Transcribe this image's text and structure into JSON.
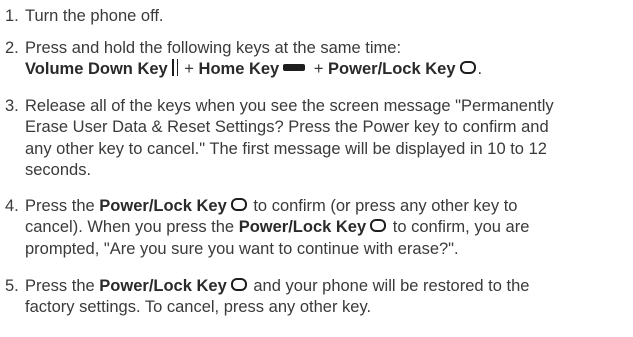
{
  "steps": [
    {
      "number": "1.",
      "text": "Turn the phone off."
    },
    {
      "number": "2.",
      "line1": "Press and hold the following keys at the same time:",
      "vol_label": "Volume Down Key",
      "plus1": " + ",
      "home_label": "Home Key",
      "plus2": " + ",
      "power_label": "Power/Lock Key",
      "end": "."
    },
    {
      "number": "3.",
      "lines": [
        "Release all of the keys when you see the screen message \"Permanently",
        "Erase User Data & Reset Settings? Press the Power key to confirm and",
        "any other key to cancel.\" The first message will be displayed in 10 to 12",
        "seconds."
      ]
    },
    {
      "number": "4.",
      "a1": "Press the ",
      "a2": "Power/Lock Key",
      "a3": " to confirm (or press any other key to",
      "b1": "cancel). When you press the ",
      "b2": "Power/Lock Key",
      "b3": " to confirm, you are",
      "c1": "prompted, \"Are you sure you want to continue with erase?\"."
    },
    {
      "number": "5.",
      "a1": "Press the ",
      "a2": "Power/Lock Key",
      "a3": " and your phone will be restored to the",
      "b1": "factory settings. To cancel, press any other key."
    }
  ],
  "icons": {
    "volume": "volume-down-key-icon",
    "home": "home-key-icon",
    "power": "power-lock-key-icon"
  }
}
